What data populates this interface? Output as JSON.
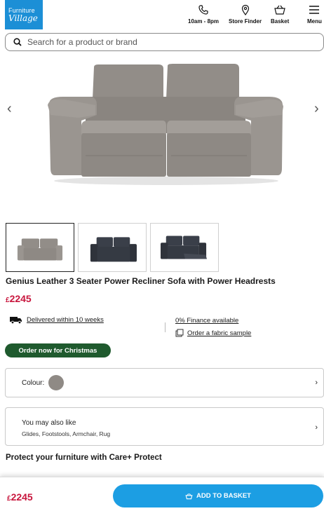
{
  "brand": {
    "line1": "Furniture",
    "line2": "Village"
  },
  "header": {
    "hours_label": "10am - 8pm",
    "store_label": "Store Finder",
    "basket_label": "Basket",
    "menu_label": "Menu"
  },
  "search": {
    "placeholder": "Search for a product or brand"
  },
  "product": {
    "title": "Genius Leather 3 Seater Power Recliner Sofa with Power Headrests",
    "currency": "£",
    "price": "2245"
  },
  "delivery": {
    "text": "Delivered within 10 weeks"
  },
  "finance": {
    "text": "0% Finance available"
  },
  "sample": {
    "text": "Order a fabric sample"
  },
  "promo": {
    "badge": "Order now for Christmas"
  },
  "colour": {
    "label": "Colour:",
    "swatch": "#8f8a85"
  },
  "also_like": {
    "heading": "You may also like",
    "items": "Glides, Footstools, Armchair, Rug"
  },
  "protect": {
    "heading": "Protect your furniture with Care+ Protect"
  },
  "footer": {
    "currency": "£",
    "price": "2245",
    "button_label": "ADD TO BASKET"
  },
  "colors": {
    "brand_blue": "#1c8fd6",
    "price_red": "#c8163d",
    "promo_green": "#1f5a2e",
    "button_blue": "#1c9ee3"
  },
  "icons": [
    "search-icon",
    "phone-icon",
    "location-pin-icon",
    "basket-icon",
    "menu-icon",
    "truck-icon",
    "fabric-sample-icon",
    "chevron-left-icon",
    "chevron-right-icon"
  ]
}
